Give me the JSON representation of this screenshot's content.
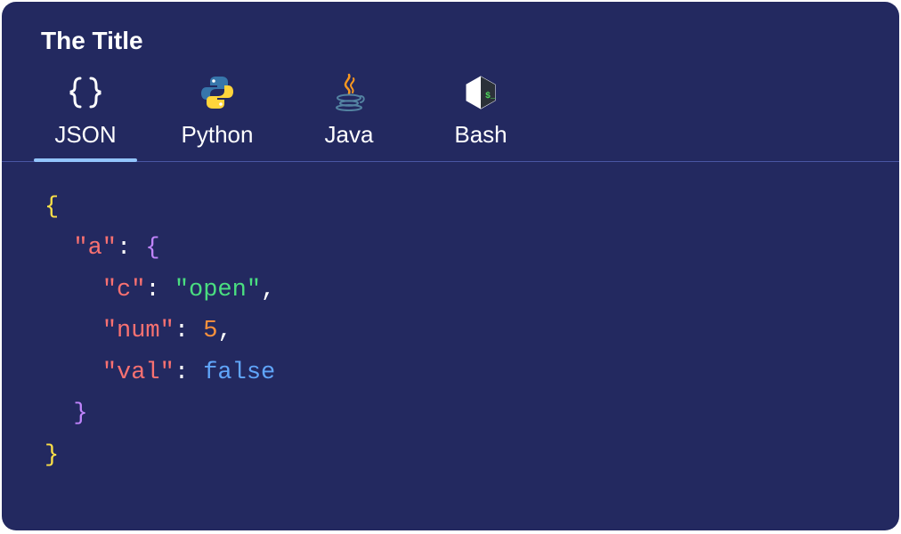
{
  "title": "The Title",
  "tabs": [
    {
      "id": "json",
      "label": "JSON",
      "active": true
    },
    {
      "id": "python",
      "label": "Python",
      "active": false
    },
    {
      "id": "java",
      "label": "Java",
      "active": false
    },
    {
      "id": "bash",
      "label": "Bash",
      "active": false
    }
  ],
  "code": {
    "language": "json",
    "tokens": [
      [
        {
          "t": "{",
          "c": "brace"
        }
      ],
      [
        {
          "t": "  ",
          "c": "ws"
        },
        {
          "t": "\"a\"",
          "c": "key"
        },
        {
          "t": ": ",
          "c": "colon"
        },
        {
          "t": "{",
          "c": "brace2"
        }
      ],
      [
        {
          "t": "    ",
          "c": "ws"
        },
        {
          "t": "\"c\"",
          "c": "key"
        },
        {
          "t": ": ",
          "c": "colon"
        },
        {
          "t": "\"open\"",
          "c": "string"
        },
        {
          "t": ",",
          "c": "punct"
        }
      ],
      [
        {
          "t": "    ",
          "c": "ws"
        },
        {
          "t": "\"num\"",
          "c": "key"
        },
        {
          "t": ": ",
          "c": "colon"
        },
        {
          "t": "5",
          "c": "number"
        },
        {
          "t": ",",
          "c": "punct"
        }
      ],
      [
        {
          "t": "    ",
          "c": "ws"
        },
        {
          "t": "\"val\"",
          "c": "key"
        },
        {
          "t": ": ",
          "c": "colon"
        },
        {
          "t": "false",
          "c": "bool"
        }
      ],
      [
        {
          "t": "  ",
          "c": "ws"
        },
        {
          "t": "}",
          "c": "brace2"
        }
      ],
      [
        {
          "t": "}",
          "c": "brace"
        }
      ]
    ],
    "raw_value": {
      "a": {
        "c": "open",
        "num": 5,
        "val": false
      }
    }
  },
  "colors": {
    "background": "#232960",
    "accent": "#93c5fd",
    "brace_outer": "#fde047",
    "brace_inner": "#c084fc",
    "key": "#f87171",
    "string": "#4ade80",
    "number": "#fb923c",
    "boolean": "#60a5fa"
  }
}
